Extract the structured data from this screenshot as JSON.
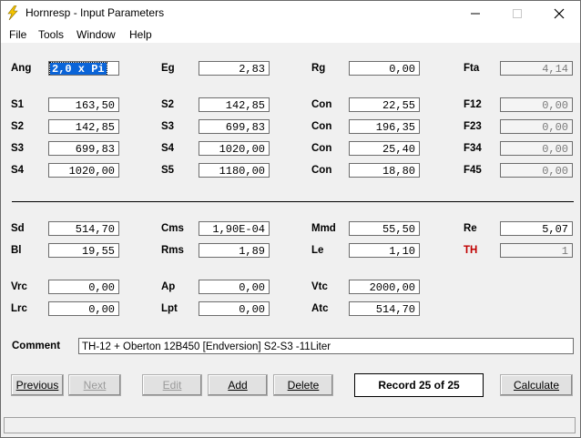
{
  "window": {
    "title": "Hornresp - Input Parameters"
  },
  "menu": [
    "File",
    "Tools",
    "Window",
    "Help"
  ],
  "params": {
    "ang": {
      "label": "Ang",
      "value": "2,0 x Pi"
    },
    "eg": {
      "label": "Eg",
      "value": "2,83"
    },
    "rg": {
      "label": "Rg",
      "value": "0,00"
    },
    "fta": {
      "label": "Fta",
      "value": "4,14"
    },
    "s1a": {
      "label": "S1",
      "value": "163,50"
    },
    "s2a": {
      "label": "S2",
      "value": "142,85"
    },
    "con1": {
      "label": "Con",
      "value": "22,55"
    },
    "f12": {
      "label": "F12",
      "value": "0,00"
    },
    "s2b": {
      "label": "S2",
      "value": "142,85"
    },
    "s3a": {
      "label": "S3",
      "value": "699,83"
    },
    "con2": {
      "label": "Con",
      "value": "196,35"
    },
    "f23": {
      "label": "F23",
      "value": "0,00"
    },
    "s3b": {
      "label": "S3",
      "value": "699,83"
    },
    "s4a": {
      "label": "S4",
      "value": "1020,00"
    },
    "con3": {
      "label": "Con",
      "value": "25,40"
    },
    "f34": {
      "label": "F34",
      "value": "0,00"
    },
    "s4b": {
      "label": "S4",
      "value": "1020,00"
    },
    "s5": {
      "label": "S5",
      "value": "1180,00"
    },
    "con4": {
      "label": "Con",
      "value": "18,80"
    },
    "f45": {
      "label": "F45",
      "value": "0,00"
    },
    "sd": {
      "label": "Sd",
      "value": "514,70"
    },
    "cms": {
      "label": "Cms",
      "value": "1,90E-04"
    },
    "mmd": {
      "label": "Mmd",
      "value": "55,50"
    },
    "re": {
      "label": "Re",
      "value": "5,07"
    },
    "bl": {
      "label": "Bl",
      "value": "19,55"
    },
    "rms": {
      "label": "Rms",
      "value": "1,89"
    },
    "le": {
      "label": "Le",
      "value": "1,10"
    },
    "th": {
      "label": "TH",
      "value": "1"
    },
    "vrc": {
      "label": "Vrc",
      "value": "0,00"
    },
    "ap": {
      "label": "Ap",
      "value": "0,00"
    },
    "vtc": {
      "label": "Vtc",
      "value": "2000,00"
    },
    "lrc": {
      "label": "Lrc",
      "value": "0,00"
    },
    "lpt": {
      "label": "Lpt",
      "value": "0,00"
    },
    "atc": {
      "label": "Atc",
      "value": "514,70"
    }
  },
  "comment": {
    "label": "Comment",
    "value": "TH-12 + Oberton 12B450 [Endversion] S2-S3 -11Liter"
  },
  "buttons": {
    "previous": "Previous",
    "next": "Next",
    "edit": "Edit",
    "add": "Add",
    "delete": "Delete",
    "calculate": "Calculate"
  },
  "record": "Record 25 of 25",
  "colors": {
    "selection": "#0a64d8",
    "th_label": "#c00000",
    "app_icon": "#f5c400"
  }
}
